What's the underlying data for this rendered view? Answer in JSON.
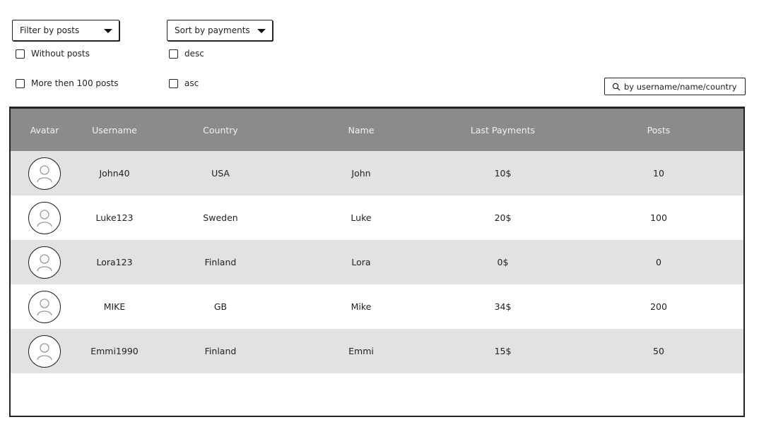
{
  "filters": {
    "filter_dropdown": {
      "label": "Filter by posts"
    },
    "sort_dropdown": {
      "label": "Sort by payments"
    },
    "filter_options": [
      "Without posts",
      "More then 100 posts"
    ],
    "sort_options": [
      "desc",
      "asc"
    ]
  },
  "search": {
    "placeholder": "by username/name/country"
  },
  "table": {
    "headers": {
      "avatar": "Avatar",
      "username": "Username",
      "country": "Country",
      "name": "Name",
      "last_payments": "Last Payments",
      "posts": "Posts"
    },
    "rows": [
      {
        "username": "John40",
        "country": "USA",
        "name": "John",
        "last_payment": "10$",
        "posts": "10"
      },
      {
        "username": "Luke123",
        "country": "Sweden",
        "name": "Luke",
        "last_payment": "20$",
        "posts": "100"
      },
      {
        "username": "Lora123",
        "country": "Finland",
        "name": "Lora",
        "last_payment": "0$",
        "posts": "0"
      },
      {
        "username": "MIKE",
        "country": "GB",
        "name": "Mike",
        "last_payment": "34$",
        "posts": "200"
      },
      {
        "username": "Emmi1990",
        "country": "Finland",
        "name": "Emmi",
        "last_payment": "15$",
        "posts": "50"
      }
    ]
  },
  "colors": {
    "header_bg": "#8b8b8b",
    "shaded_row": "#e2e2e2"
  },
  "icons": {
    "avatar": "user-avatar-icon",
    "search": "search-icon",
    "caret": "caret-down-icon"
  }
}
